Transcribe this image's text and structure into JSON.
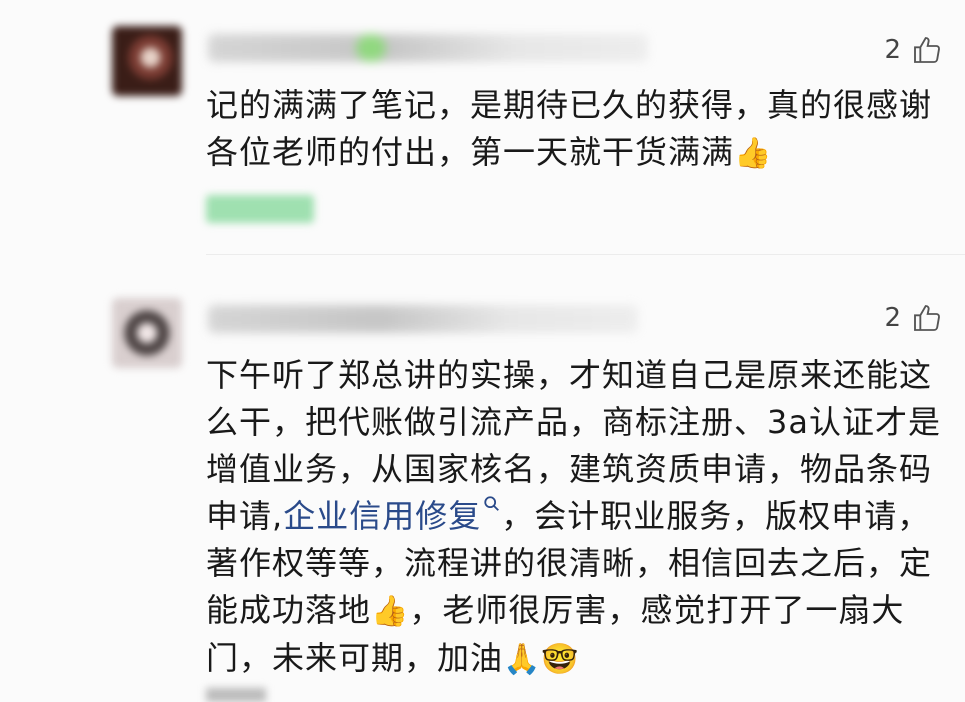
{
  "comments": [
    {
      "likes": "2",
      "text": "记的满满了笔记，是期待已久的获得，真的很感谢各位老师的付出，第一天就干货满满",
      "emoji_end": "👍"
    },
    {
      "likes": "2",
      "text_before_link": "下午听了郑总讲的实操，才知道自己是原来还能这么干，把代账做引流产品，商标注册、3a认证才是增值业务，从国家核名，建筑资质申请，物品条码申请,",
      "link": "企业信用修复",
      "text_after_link": "，会计职业服务，版权申请，著作权等等，流程讲的很清晰，相信回去之后，定能成功落地",
      "emoji_mid": "👍",
      "text_tail": "，老师很厉害，感觉打开了一扇大门，未来可期，加油",
      "emoji_pray": "🙏",
      "emoji_666": "🤓"
    }
  ],
  "icons": {
    "like": "thumbs-up-outline-icon",
    "search": "search-icon"
  },
  "colors": {
    "link": "#2a4a8a",
    "text": "#191919",
    "background": "#fbfbfb"
  }
}
